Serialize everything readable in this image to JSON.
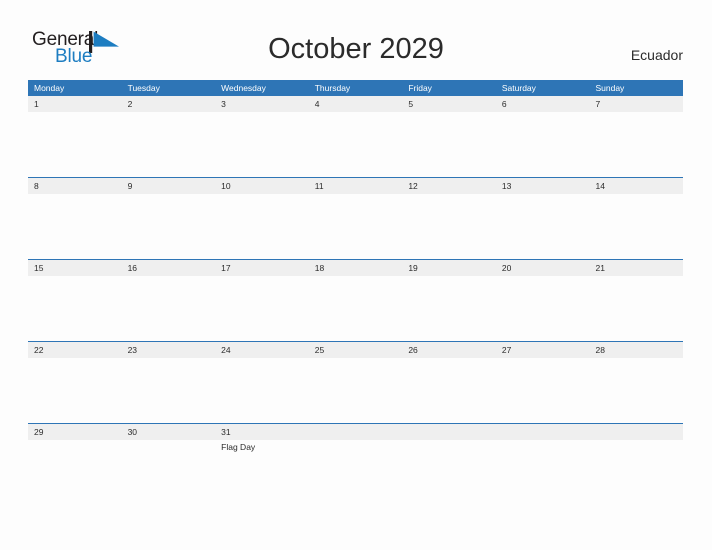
{
  "brand": {
    "name_part1": "General",
    "name_part2": "Blue",
    "flag_icon": "flag-triangle-icon",
    "color_dark": "#231f20",
    "color_blue": "#1d7dc1"
  },
  "header": {
    "title": "October 2029",
    "country": "Ecuador"
  },
  "colors": {
    "header_blue": "#2e75b6",
    "row_border_blue": "#2e75b6",
    "day_band_gray": "#efefef",
    "page_background": "#fdfdfd",
    "text_dark": "#2b2b2b"
  },
  "calendar": {
    "weekdays": [
      "Monday",
      "Tuesday",
      "Wednesday",
      "Thursday",
      "Friday",
      "Saturday",
      "Sunday"
    ],
    "weeks": [
      {
        "days": [
          {
            "num": "1",
            "event": ""
          },
          {
            "num": "2",
            "event": ""
          },
          {
            "num": "3",
            "event": ""
          },
          {
            "num": "4",
            "event": ""
          },
          {
            "num": "5",
            "event": ""
          },
          {
            "num": "6",
            "event": ""
          },
          {
            "num": "7",
            "event": ""
          }
        ]
      },
      {
        "days": [
          {
            "num": "8",
            "event": ""
          },
          {
            "num": "9",
            "event": ""
          },
          {
            "num": "10",
            "event": ""
          },
          {
            "num": "11",
            "event": ""
          },
          {
            "num": "12",
            "event": ""
          },
          {
            "num": "13",
            "event": ""
          },
          {
            "num": "14",
            "event": ""
          }
        ]
      },
      {
        "days": [
          {
            "num": "15",
            "event": ""
          },
          {
            "num": "16",
            "event": ""
          },
          {
            "num": "17",
            "event": ""
          },
          {
            "num": "18",
            "event": ""
          },
          {
            "num": "19",
            "event": ""
          },
          {
            "num": "20",
            "event": ""
          },
          {
            "num": "21",
            "event": ""
          }
        ]
      },
      {
        "days": [
          {
            "num": "22",
            "event": ""
          },
          {
            "num": "23",
            "event": ""
          },
          {
            "num": "24",
            "event": ""
          },
          {
            "num": "25",
            "event": ""
          },
          {
            "num": "26",
            "event": ""
          },
          {
            "num": "27",
            "event": ""
          },
          {
            "num": "28",
            "event": ""
          }
        ]
      },
      {
        "days": [
          {
            "num": "29",
            "event": ""
          },
          {
            "num": "30",
            "event": ""
          },
          {
            "num": "31",
            "event": "Flag Day"
          },
          {
            "num": "",
            "event": ""
          },
          {
            "num": "",
            "event": ""
          },
          {
            "num": "",
            "event": ""
          },
          {
            "num": "",
            "event": ""
          }
        ]
      }
    ]
  }
}
